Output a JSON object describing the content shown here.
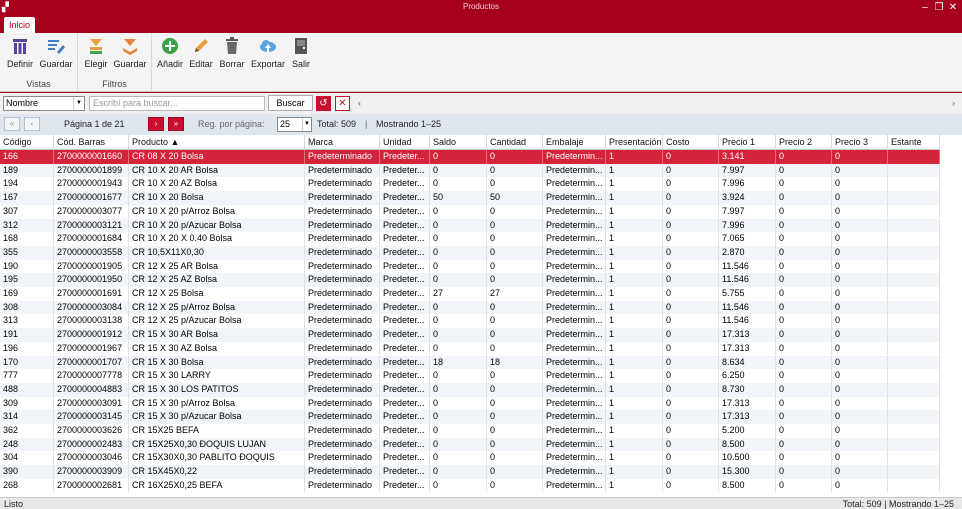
{
  "window": {
    "title": "Productos",
    "minimize": "–",
    "restore": "❐",
    "close": "✕"
  },
  "tabs": [
    {
      "label": "Inicio"
    }
  ],
  "ribbon": {
    "vistas": {
      "title": "Vistas",
      "definir": "Definir",
      "guardar": "Guardar"
    },
    "filtros": {
      "title": "Filtros",
      "elegir": "Elegir",
      "guardar": "Guardar"
    },
    "acciones": {
      "anadir": "Añadir",
      "editar": "Editar",
      "borrar": "Borrar",
      "exportar": "Exportar",
      "salir": "Salir"
    }
  },
  "search": {
    "field": "Nombre",
    "placeholder": "Escribí para buscar...",
    "button": "Buscar",
    "reset_icon": "↺",
    "clear_icon": "✕",
    "left_chevron": "‹",
    "right_chevron": "›"
  },
  "pager": {
    "first": "«",
    "prev": "‹",
    "next": "›",
    "last": "»",
    "page_text": "Página 1 de 21",
    "per_page_label": "Reg. por página:",
    "per_page": "25",
    "total": "Total: 509",
    "sep": "|",
    "showing": "Mostrando 1–25"
  },
  "grid": {
    "columns": [
      "Código",
      "Cód. Barras",
      "Producto ▲",
      "Marca",
      "Unidad",
      "Saldo",
      "Cantidad",
      "Embalaje",
      "Presentación",
      "Costo",
      "Precio 1",
      "Precio 2",
      "Precio 3",
      "Estante"
    ],
    "rows": [
      [
        "166",
        "2700000001660",
        "CR 08 X 20 Bolsa",
        "Predeterminado",
        "Predeter...",
        "0",
        "0",
        "Predetermin...",
        "1",
        "0",
        "3.141",
        "0",
        "0",
        ""
      ],
      [
        "189",
        "2700000001899",
        "CR 10 X 20 AR Bolsa",
        "Predeterminado",
        "Predeter...",
        "0",
        "0",
        "Predetermin...",
        "1",
        "0",
        "7.997",
        "0",
        "0",
        ""
      ],
      [
        "194",
        "2700000001943",
        "CR 10 X 20 AZ Bolsa",
        "Predeterminado",
        "Predeter...",
        "0",
        "0",
        "Predetermin...",
        "1",
        "0",
        "7.996",
        "0",
        "0",
        ""
      ],
      [
        "167",
        "2700000001677",
        "CR 10 X 20 Bolsa",
        "Predeterminado",
        "Predeter...",
        "50",
        "50",
        "Predetermin...",
        "1",
        "0",
        "3.924",
        "0",
        "0",
        ""
      ],
      [
        "307",
        "2700000003077",
        "CR 10 X 20 p/Arroz Bolsa",
        "Predeterminado",
        "Predeter...",
        "0",
        "0",
        "Predetermin...",
        "1",
        "0",
        "7.997",
        "0",
        "0",
        ""
      ],
      [
        "312",
        "2700000003121",
        "CR 10 X 20 p/Azucar Bolsa",
        "Predeterminado",
        "Predeter...",
        "0",
        "0",
        "Predetermin...",
        "1",
        "0",
        "7.996",
        "0",
        "0",
        ""
      ],
      [
        "168",
        "2700000001684",
        "CR 10 X 20 X 0.40 Bolsa",
        "Predeterminado",
        "Predeter...",
        "0",
        "0",
        "Predetermin...",
        "1",
        "0",
        "7.065",
        "0",
        "0",
        ""
      ],
      [
        "355",
        "2700000003558",
        "CR 10,5X11X0,30",
        "Predeterminado",
        "Predeter...",
        "0",
        "0",
        "Predetermin...",
        "1",
        "0",
        "2.870",
        "0",
        "0",
        ""
      ],
      [
        "190",
        "2700000001905",
        "CR 12 X 25 AR Bolsa",
        "Predeterminado",
        "Predeter...",
        "0",
        "0",
        "Predetermin...",
        "1",
        "0",
        "11.546",
        "0",
        "0",
        ""
      ],
      [
        "195",
        "2700000001950",
        "CR 12 X 25 AZ Bolsa",
        "Predeterminado",
        "Predeter...",
        "0",
        "0",
        "Predetermin...",
        "1",
        "0",
        "11.546",
        "0",
        "0",
        ""
      ],
      [
        "169",
        "2700000001691",
        "CR 12 X 25 Bolsa",
        "Predeterminado",
        "Predeter...",
        "27",
        "27",
        "Predetermin...",
        "1",
        "0",
        "5.755",
        "0",
        "0",
        ""
      ],
      [
        "308",
        "2700000003084",
        "CR 12 X 25 p/Arroz Bolsa",
        "Predeterminado",
        "Predeter...",
        "0",
        "0",
        "Predetermin...",
        "1",
        "0",
        "11.546",
        "0",
        "0",
        ""
      ],
      [
        "313",
        "2700000003138",
        "CR 12 X 25 p/Azucar Bolsa",
        "Predeterminado",
        "Predeter...",
        "0",
        "0",
        "Predetermin...",
        "1",
        "0",
        "11.546",
        "0",
        "0",
        ""
      ],
      [
        "191",
        "2700000001912",
        "CR 15 X 30 AR Bolsa",
        "Predeterminado",
        "Predeter...",
        "0",
        "0",
        "Predetermin...",
        "1",
        "0",
        "17.313",
        "0",
        "0",
        ""
      ],
      [
        "196",
        "2700000001967",
        "CR 15 X 30 AZ Bolsa",
        "Predeterminado",
        "Predeter...",
        "0",
        "0",
        "Predetermin...",
        "1",
        "0",
        "17.313",
        "0",
        "0",
        ""
      ],
      [
        "170",
        "2700000001707",
        "CR 15 X 30 Bolsa",
        "Predeterminado",
        "Predeter...",
        "18",
        "18",
        "Predetermin...",
        "1",
        "0",
        "8.634",
        "0",
        "0",
        ""
      ],
      [
        "777",
        "2700000007778",
        "CR 15 X 30 LARRY",
        "Predeterminado",
        "Predeter...",
        "0",
        "0",
        "Predetermin...",
        "1",
        "0",
        "6.250",
        "0",
        "0",
        ""
      ],
      [
        "488",
        "2700000004883",
        "CR 15 X 30 LOS PATITOS",
        "Predeterminado",
        "Predeter...",
        "0",
        "0",
        "Predetermin...",
        "1",
        "0",
        "8.730",
        "0",
        "0",
        ""
      ],
      [
        "309",
        "2700000003091",
        "CR 15 X 30 p/Arroz Bolsa",
        "Predeterminado",
        "Predeter...",
        "0",
        "0",
        "Predetermin...",
        "1",
        "0",
        "17.313",
        "0",
        "0",
        ""
      ],
      [
        "314",
        "2700000003145",
        "CR 15 X 30 p/Azucar Bolsa",
        "Predeterminado",
        "Predeter...",
        "0",
        "0",
        "Predetermin...",
        "1",
        "0",
        "17.313",
        "0",
        "0",
        ""
      ],
      [
        "362",
        "2700000003626",
        "CR 15X25 BEFA",
        "Predeterminado",
        "Predeter...",
        "0",
        "0",
        "Predetermin...",
        "1",
        "0",
        "5.200",
        "0",
        "0",
        ""
      ],
      [
        "248",
        "2700000002483",
        "CR 15X25X0,30 ĐOQUIS LUJAN",
        "Predeterminado",
        "Predeter...",
        "0",
        "0",
        "Predetermin...",
        "1",
        "0",
        "8.500",
        "0",
        "0",
        ""
      ],
      [
        "304",
        "2700000003046",
        "CR 15X30X0,30 PABLITO ĐOQUIS",
        "Predeterminado",
        "Predeter...",
        "0",
        "0",
        "Predetermin...",
        "1",
        "0",
        "10.500",
        "0",
        "0",
        ""
      ],
      [
        "390",
        "2700000003909",
        "CR 15X45X0,22",
        "Predeterminado",
        "Predeter...",
        "0",
        "0",
        "Predetermin...",
        "1",
        "0",
        "15.300",
        "0",
        "0",
        ""
      ],
      [
        "268",
        "2700000002681",
        "CR 16X25X0,25 BEFA",
        "Predeterminado",
        "Predeter...",
        "0",
        "0",
        "Predetermin...",
        "1",
        "0",
        "8.500",
        "0",
        "0",
        ""
      ]
    ]
  },
  "status": {
    "left": "Listo",
    "right": "Total: 509   |   Mostrando 1–25"
  },
  "colors": {
    "brand": "#a5001e",
    "selected_row": "#d3243c",
    "pager_bg": "#dfe6ee"
  }
}
